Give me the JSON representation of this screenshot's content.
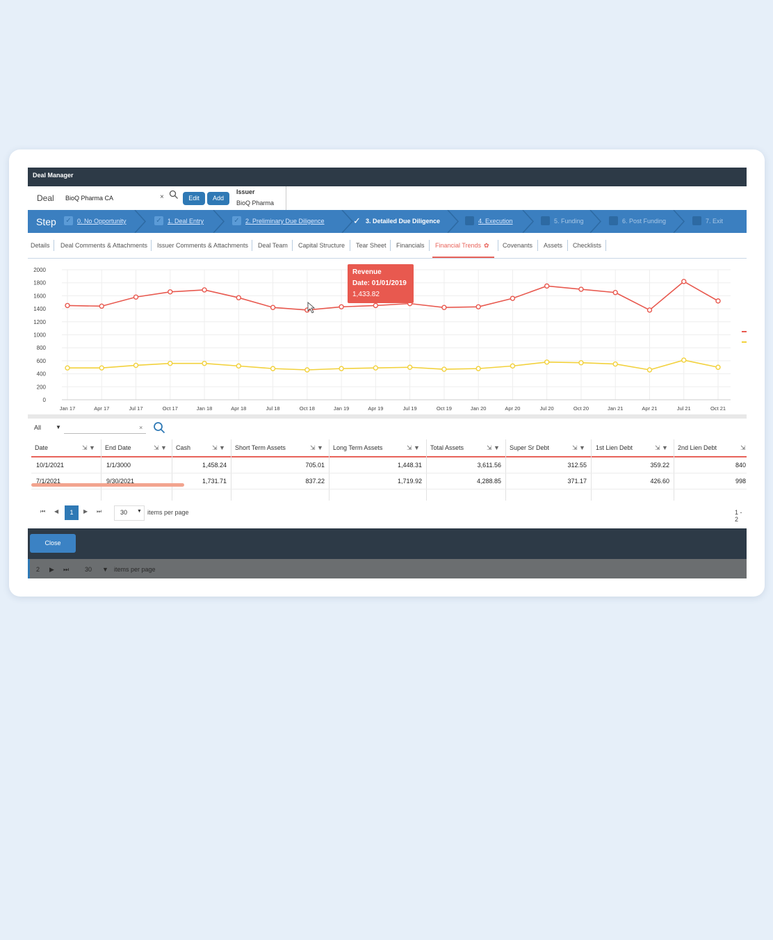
{
  "window": {
    "title": "Deal Manager"
  },
  "deal": {
    "label": "Deal",
    "value": "BioQ Pharma CA",
    "clear": "×",
    "edit_label": "Edit",
    "add_label": "Add"
  },
  "issuer": {
    "title": "Issuer",
    "value": "BioQ Pharma"
  },
  "steps": {
    "label": "Step",
    "items": [
      {
        "label": "0. No Opportunity",
        "state": "done"
      },
      {
        "label": "1. Deal Entry",
        "state": "done"
      },
      {
        "label": "2. Preliminary Due Diligence",
        "state": "done"
      },
      {
        "label": "3. Detailed Due Diligence",
        "state": "active"
      },
      {
        "label": "4. Execution",
        "state": "next"
      },
      {
        "label": "5. Funding",
        "state": "future"
      },
      {
        "label": "6. Post Funding",
        "state": "future"
      },
      {
        "label": "7. Exit",
        "state": "future"
      }
    ]
  },
  "tabs": [
    "Details",
    "Deal Comments & Attachments",
    "Issuer Comments & Attachments",
    "Deal Team",
    "Capital Structure",
    "Tear Sheet",
    "Financials",
    "Financial Trends",
    "Covenants",
    "Assets",
    "Checklists"
  ],
  "active_tab": "Financial Trends",
  "tooltip": {
    "title": "Revenue",
    "date": "Date: 01/01/2019",
    "value": "1,433.82"
  },
  "colors": {
    "revenue": "#e8594f",
    "second_series": "#f2d13c",
    "accent": "#2f79b5",
    "dark": "#2d3a47"
  },
  "chart_data": {
    "type": "line",
    "x": [
      "Jan 17",
      "Apr 17",
      "Jul 17",
      "Oct 17",
      "Jan 18",
      "Apr 18",
      "Jul 18",
      "Oct 18",
      "Jan 19",
      "Apr 19",
      "Jul 19",
      "Oct 19",
      "Jan 20",
      "Apr 20",
      "Jul 20",
      "Oct 20",
      "Jan 21",
      "Apr 21",
      "Jul 21",
      "Oct 21"
    ],
    "series": [
      {
        "name": "Revenue",
        "color": "#e8594f",
        "values": [
          1450,
          1440,
          1580,
          1660,
          1690,
          1570,
          1420,
          1380,
          1430,
          1450,
          1480,
          1420,
          1430,
          1560,
          1750,
          1700,
          1650,
          1380,
          1820,
          1520
        ]
      },
      {
        "color": "#f2d13c",
        "values": [
          490,
          490,
          530,
          560,
          560,
          520,
          480,
          460,
          480,
          490,
          500,
          470,
          480,
          520,
          580,
          570,
          550,
          460,
          610,
          500
        ]
      }
    ],
    "yticks": [
      0,
      200,
      400,
      600,
      800,
      1000,
      1200,
      1400,
      1600,
      1800,
      2000
    ],
    "ylim": [
      0,
      2000
    ],
    "grid": true,
    "legend": "right"
  },
  "filter": {
    "selected": "All",
    "clear": "×"
  },
  "table": {
    "columns": [
      "Date",
      "End Date",
      "Cash",
      "Short Term Assets",
      "Long Term Assets",
      "Total Assets",
      "Super Sr Debt",
      "1st Lien Debt",
      "2nd Lien Debt"
    ],
    "rows": [
      [
        "10/1/2021",
        "1/1/3000",
        "1,458.24",
        "705.01",
        "1,448.31",
        "3,611.56",
        "312.55",
        "359.22",
        "840"
      ],
      [
        "7/1/2021",
        "9/30/2021",
        "1,731.71",
        "837.22",
        "1,719.92",
        "4,288.85",
        "371.17",
        "426.60",
        "998"
      ]
    ]
  },
  "pager": {
    "current": "1",
    "page_size": "30",
    "items_label": "items per page",
    "range": "1 - 2"
  },
  "footer": {
    "close_label": "Close"
  },
  "underlay": {
    "page": "2",
    "page_size": "30",
    "items_label": "items per page"
  }
}
